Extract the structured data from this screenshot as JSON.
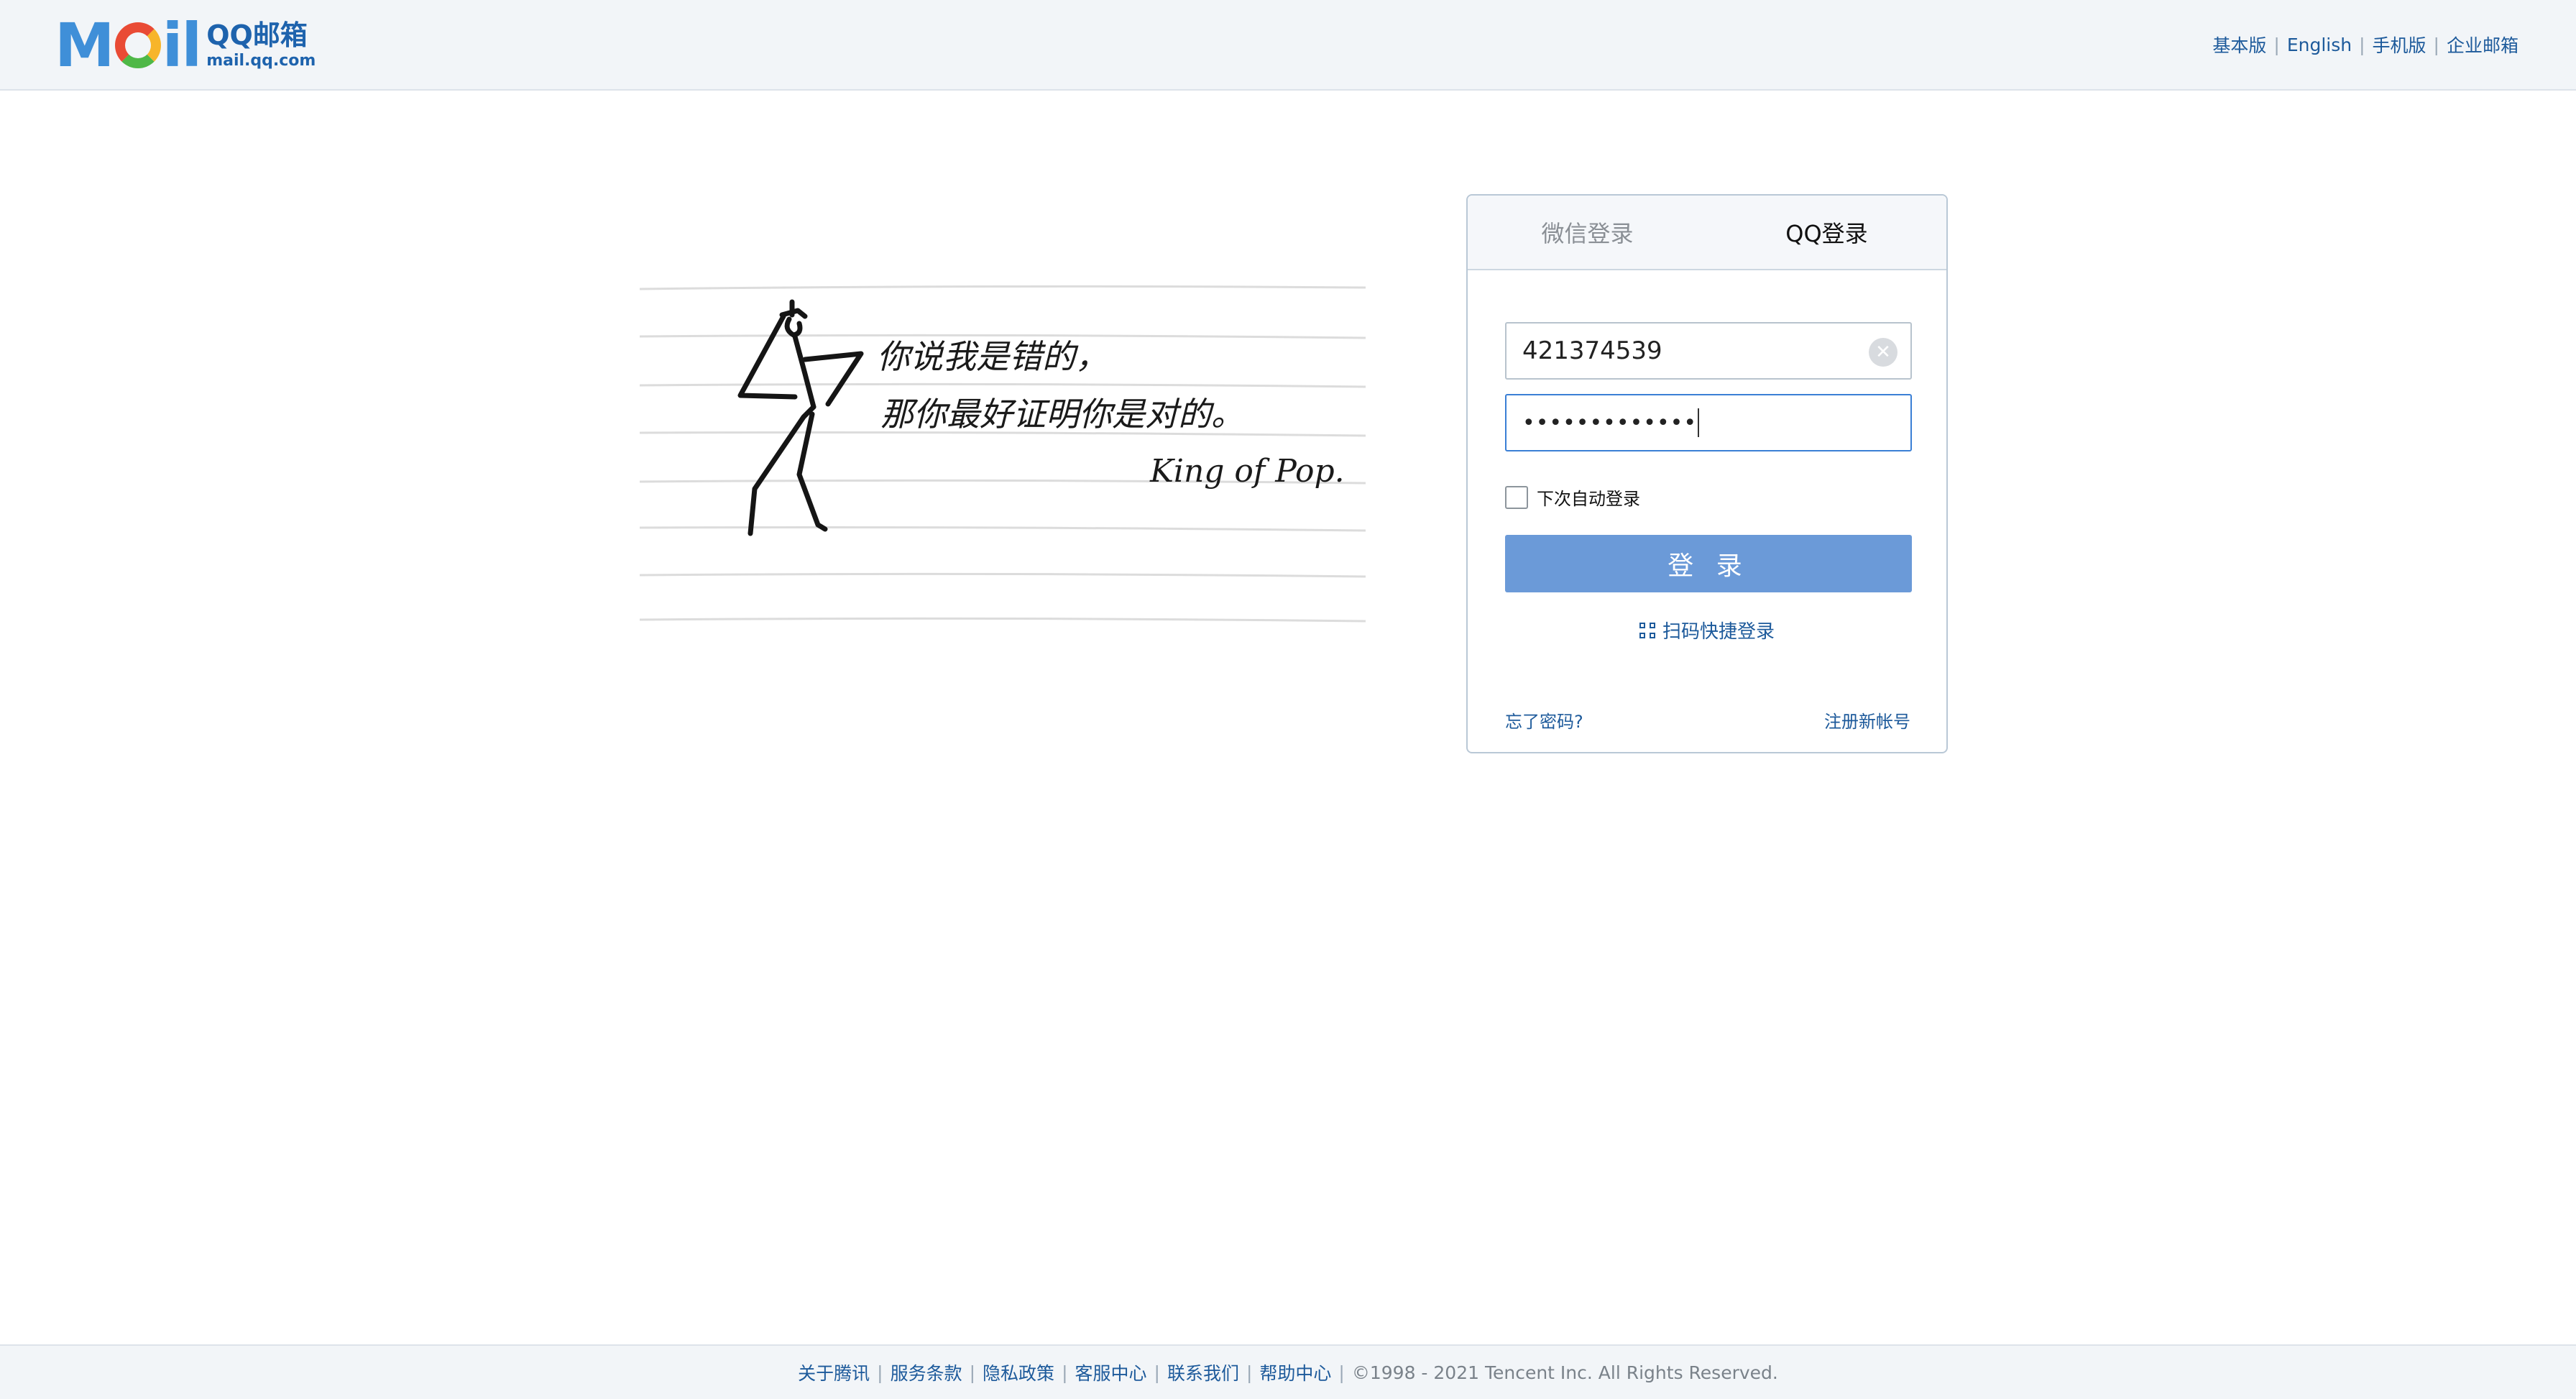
{
  "header": {
    "logo": {
      "word": "MOil",
      "title": "QQ邮箱",
      "subtitle": "mail.qq.com"
    },
    "nav": [
      "基本版",
      "English",
      "手机版",
      "企业邮箱"
    ]
  },
  "illustration": {
    "line1": "你说我是错的，",
    "line2": "那你最好证明你是对的。",
    "signature": "King of Pop."
  },
  "login": {
    "tabs": [
      {
        "label": "微信登录",
        "active": false
      },
      {
        "label": "QQ登录",
        "active": true
      }
    ],
    "account_value": "421374539",
    "password_mask": "•••••••••••••",
    "remember_label": "下次自动登录",
    "submit_label": "登 录",
    "qr_label": "扫码快捷登录",
    "forgot_label": "忘了密码?",
    "register_label": "注册新帐号"
  },
  "footer": {
    "links": [
      "关于腾讯",
      "服务条款",
      "隐私政策",
      "客服中心",
      "联系我们",
      "帮助中心"
    ],
    "copyright": "©1998 - 2021 Tencent Inc. All Rights Reserved."
  },
  "colors": {
    "accent": "#6b9ad8",
    "link": "#1d5a9b",
    "header_bg": "#f2f5f8"
  }
}
